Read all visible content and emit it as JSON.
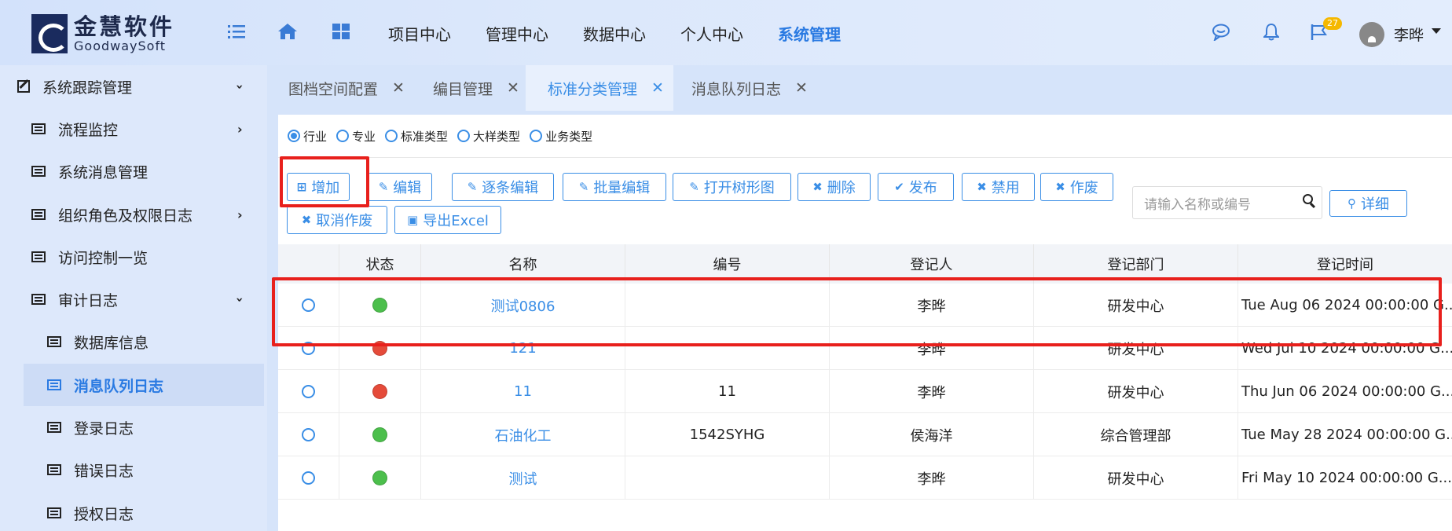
{
  "brand": {
    "name_cn": "金慧软件",
    "name_en": "GoodwaySoft"
  },
  "nav": {
    "items": [
      "项目中心",
      "管理中心",
      "数据中心",
      "个人中心",
      "系统管理"
    ],
    "active": "系统管理"
  },
  "header_right": {
    "notification_badge": "27",
    "user_name": "李晔"
  },
  "sidebar": {
    "items": [
      {
        "label": "系统跟踪管理",
        "icon": "edit-icon",
        "expand": "down"
      },
      {
        "label": "流程监控",
        "icon": "list-icon",
        "expand": "right"
      },
      {
        "label": "系统消息管理",
        "icon": "list-icon",
        "expand": ""
      },
      {
        "label": "组织角色及权限日志",
        "icon": "list-icon",
        "expand": "right"
      },
      {
        "label": "访问控制一览",
        "icon": "list-icon",
        "expand": ""
      },
      {
        "label": "审计日志",
        "icon": "list-icon",
        "expand": "down"
      },
      {
        "label": "数据库信息",
        "icon": "list-icon",
        "expand": ""
      },
      {
        "label": "消息队列日志",
        "icon": "list-icon",
        "expand": "",
        "active": true
      },
      {
        "label": "登录日志",
        "icon": "list-icon",
        "expand": ""
      },
      {
        "label": "错误日志",
        "icon": "list-icon",
        "expand": ""
      },
      {
        "label": "授权日志",
        "icon": "list-icon",
        "expand": ""
      }
    ]
  },
  "tabs": [
    {
      "label": "图档空间配置"
    },
    {
      "label": "编目管理"
    },
    {
      "label": "标准分类管理",
      "active": true
    },
    {
      "label": "消息队列日志"
    }
  ],
  "filters": {
    "options": [
      "行业",
      "专业",
      "标准类型",
      "大样类型",
      "业务类型"
    ],
    "selected": "行业"
  },
  "toolbar": {
    "buttons": [
      {
        "label": "增加",
        "icon": "plus-icon"
      },
      {
        "label": "编辑",
        "icon": "edit-icon"
      },
      {
        "label": "逐条编辑",
        "icon": "edit-icon"
      },
      {
        "label": "批量编辑",
        "icon": "edit-icon"
      },
      {
        "label": "打开树形图",
        "icon": "edit-icon"
      },
      {
        "label": "删除",
        "icon": "x-icon"
      },
      {
        "label": "发布",
        "icon": "check-icon"
      },
      {
        "label": "禁用",
        "icon": "x-icon"
      },
      {
        "label": "作废",
        "icon": "x-icon"
      },
      {
        "label": "取消作废",
        "icon": "x-icon"
      },
      {
        "label": "导出Excel",
        "icon": "excel-icon"
      }
    ],
    "search_placeholder": "请输入名称或编号",
    "detail_label": "详细"
  },
  "table": {
    "columns": [
      "",
      "状态",
      "名称",
      "编号",
      "登记人",
      "登记部门",
      "登记时间"
    ],
    "rows": [
      {
        "status": "green",
        "name": "测试0806",
        "code": "",
        "registrant": "李晔",
        "dept": "研发中心",
        "time": "Tue Aug 06 2024 00:00:00 G..."
      },
      {
        "status": "red",
        "name": "121",
        "code": "",
        "registrant": "李晔",
        "dept": "研发中心",
        "time": "Wed Jul 10 2024 00:00:00 G..."
      },
      {
        "status": "red",
        "name": "11",
        "code": "11",
        "registrant": "李晔",
        "dept": "研发中心",
        "time": "Thu Jun 06 2024 00:00:00 G..."
      },
      {
        "status": "green",
        "name": "石油化工",
        "code": "1542SYHG",
        "registrant": "侯海洋",
        "dept": "综合管理部",
        "time": "Tue May 28 2024 00:00:00 G..."
      },
      {
        "status": "green",
        "name": "测试",
        "code": "",
        "registrant": "李晔",
        "dept": "研发中心",
        "time": "Fri May 10 2024 00:00:00 G..."
      }
    ]
  },
  "colors": {
    "accent": "#3a8ee6",
    "status_green": "#4cbf4c",
    "status_red": "#e54b3a",
    "highlight": "#e8201c"
  }
}
